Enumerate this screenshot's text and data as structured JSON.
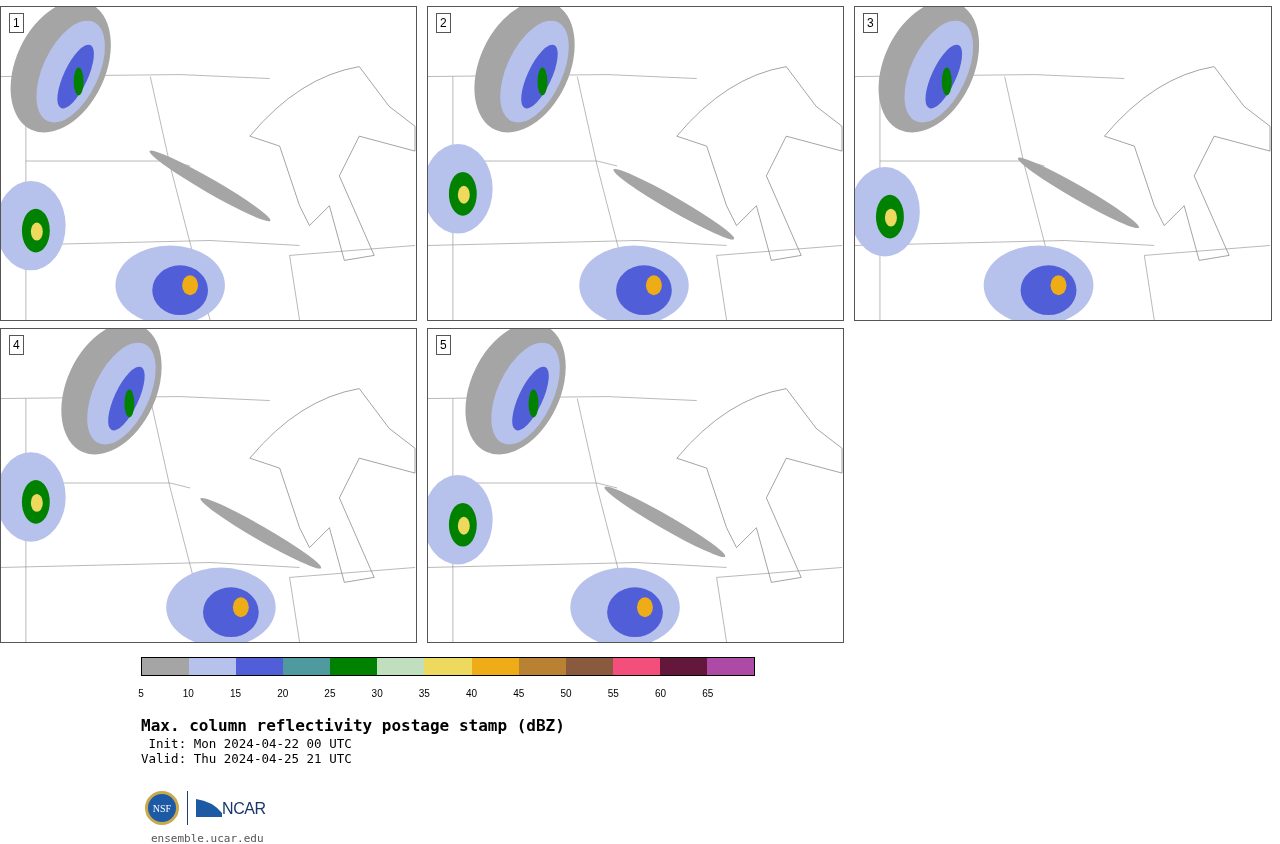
{
  "panels": [
    {
      "label": "1"
    },
    {
      "label": "2"
    },
    {
      "label": "3"
    },
    {
      "label": "4"
    },
    {
      "label": "5"
    }
  ],
  "colorbar": {
    "segments": [
      {
        "color": "#a5a5a5"
      },
      {
        "color": "#b7c2ec"
      },
      {
        "color": "#505fd7"
      },
      {
        "color": "#4e9a9f"
      },
      {
        "color": "#008200"
      },
      {
        "color": "#bfdfbf"
      },
      {
        "color": "#eed95f"
      },
      {
        "color": "#eeac17"
      },
      {
        "color": "#b98233"
      },
      {
        "color": "#8a5a3e"
      },
      {
        "color": "#f44f7c"
      },
      {
        "color": "#63173a"
      },
      {
        "color": "#ac4aa6"
      }
    ],
    "ticks": [
      "5",
      "10",
      "15",
      "20",
      "25",
      "30",
      "35",
      "40",
      "45",
      "50",
      "55",
      "60",
      "65"
    ]
  },
  "title": "Max. column reflectivity postage stamp (dBZ)",
  "init": " Init: Mon 2024-04-22 00 UTC",
  "valid": "Valid: Thu 2024-04-25 21 UTC",
  "logo": {
    "nsf": "NSF",
    "ncar": "NCAR"
  },
  "url": "ensemble.ucar.edu"
}
